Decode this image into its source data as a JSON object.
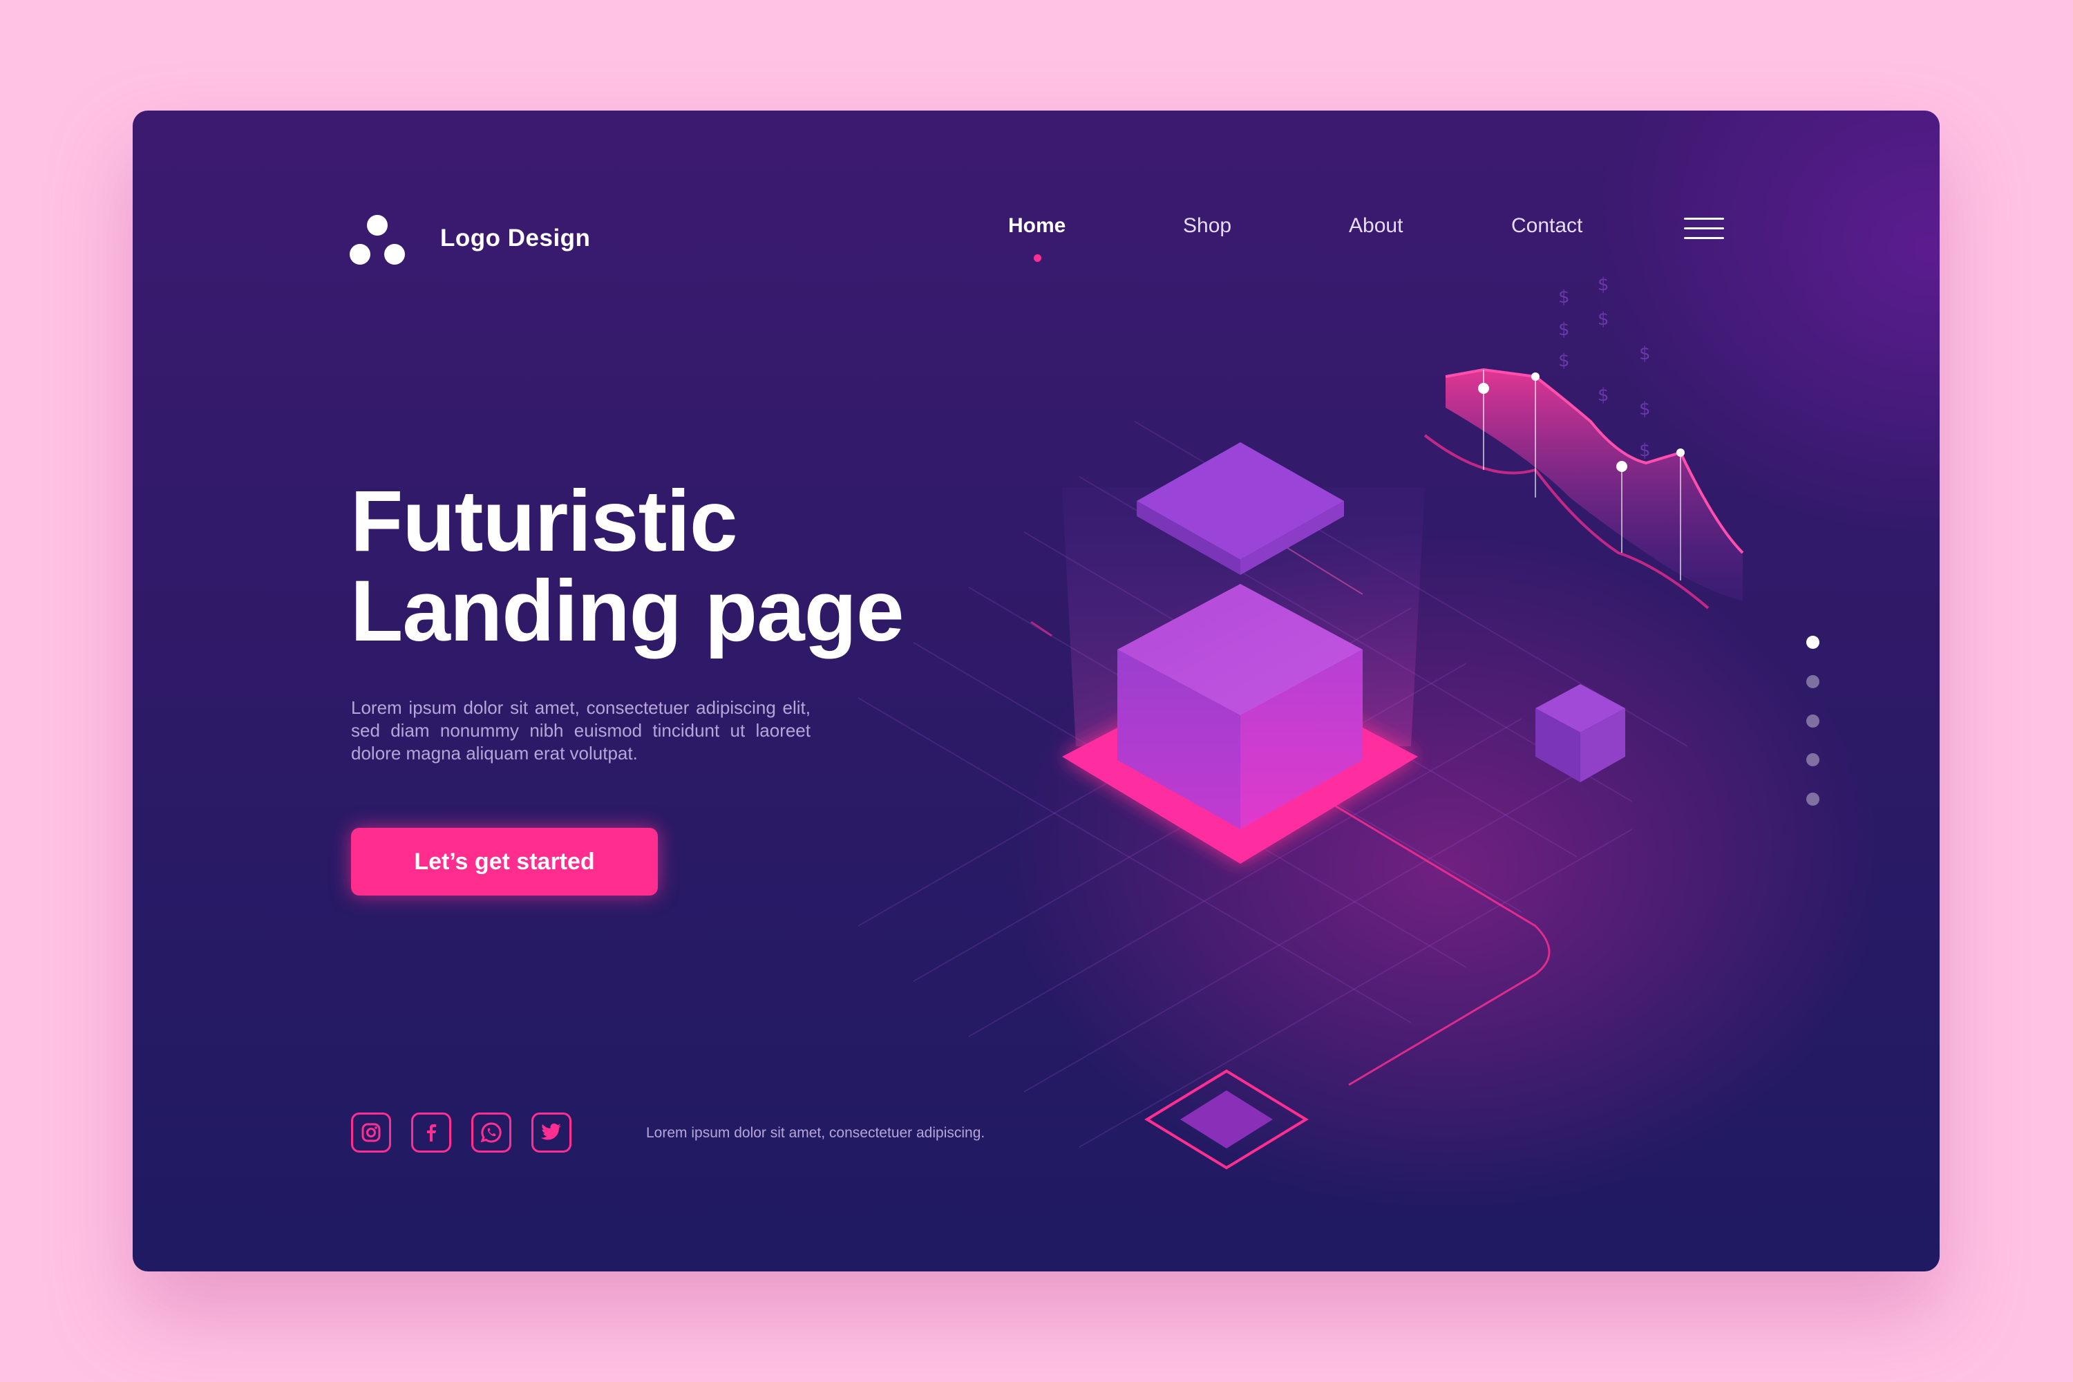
{
  "logo": {
    "text": "Logo Design",
    "icon": "three-circles-logo-icon"
  },
  "nav": {
    "items": [
      {
        "label": "Home",
        "active": true
      },
      {
        "label": "Shop",
        "active": false
      },
      {
        "label": "About",
        "active": false
      },
      {
        "label": "Contact",
        "active": false
      }
    ],
    "menu_icon": "hamburger-icon"
  },
  "hero": {
    "title_line1": "Futuristic",
    "title_line2": "Landing page",
    "description": "Lorem ipsum dolor sit amet, consectetuer adipiscing elit, sed diam nonummy nibh euismod tincidunt ut laoreet dolore magna aliquam erat volutpat.",
    "cta_label": "Let’s get started"
  },
  "socials": [
    {
      "icon": "instagram-icon"
    },
    {
      "icon": "facebook-icon"
    },
    {
      "icon": "whatsapp-icon"
    },
    {
      "icon": "twitter-icon"
    }
  ],
  "footer": {
    "text": "Lorem ipsum dolor sit amet, consectetuer adipiscing."
  },
  "pagination": {
    "total": 5,
    "active_index": 0
  },
  "colors": {
    "page_background": "#ffc2e4",
    "card_background": "#2f1a68",
    "accent": "#ff2d8d",
    "text_primary": "#ffffff",
    "text_muted": "#b6a6d8"
  }
}
